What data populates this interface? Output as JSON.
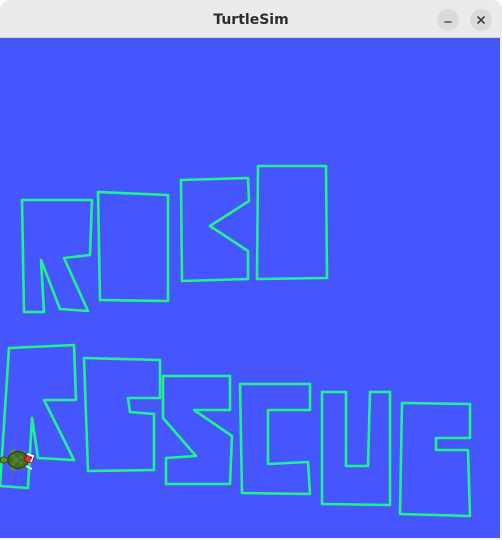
{
  "window": {
    "title": "TurtleSim",
    "buttons": {
      "minimize_icon": "minimize-icon",
      "close_icon": "close-icon"
    }
  },
  "canvas": {
    "background_color": "#4556ff",
    "pen_color": "#1ff48a",
    "turtle_icon": "turtle-icon"
  }
}
